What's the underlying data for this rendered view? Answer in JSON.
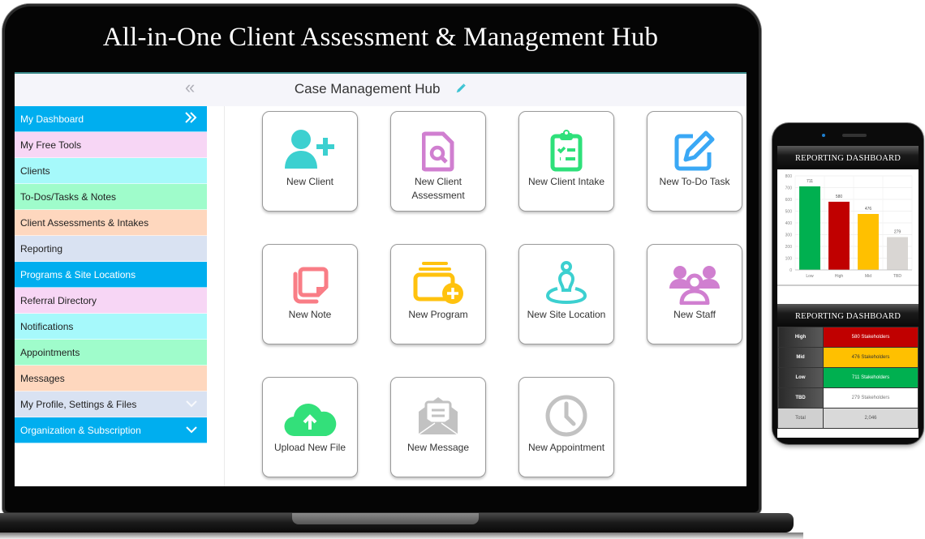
{
  "laptop": {
    "banner_title": "All-in-One Client Assessment & Management Hub",
    "header": {
      "collapse_icon": "double-chevron-left",
      "title": "Case Management Hub",
      "edit_icon": "pencil-icon"
    },
    "sidebar": {
      "items": [
        {
          "label": "My Dashboard",
          "bg": "#00aeef",
          "text_color": "#ffffff",
          "icon": "double-chevron-right"
        },
        {
          "label": "My Free Tools",
          "bg": "#f7d6f5",
          "text_color": "#222222",
          "icon": ""
        },
        {
          "label": "Clients",
          "bg": "#a6f9fb",
          "text_color": "#222222",
          "icon": ""
        },
        {
          "label": "To-Dos/Tasks & Notes",
          "bg": "#9ffccb",
          "text_color": "#222222",
          "icon": ""
        },
        {
          "label": "Client Assessments & Intakes",
          "bg": "#fed7be",
          "text_color": "#222222",
          "icon": ""
        },
        {
          "label": "Reporting",
          "bg": "#d9e2f2",
          "text_color": "#222222",
          "icon": ""
        },
        {
          "label": "Programs & Site Locations",
          "bg": "#00aeef",
          "text_color": "#ffffff",
          "icon": ""
        },
        {
          "label": "Referral Directory",
          "bg": "#f7d6f5",
          "text_color": "#222222",
          "icon": ""
        },
        {
          "label": "Notifications",
          "bg": "#a6f9fb",
          "text_color": "#222222",
          "icon": ""
        },
        {
          "label": "Appointments",
          "bg": "#9ffccb",
          "text_color": "#222222",
          "icon": ""
        },
        {
          "label": "Messages",
          "bg": "#fed7be",
          "text_color": "#222222",
          "icon": ""
        },
        {
          "label": "My Profile, Settings & Files",
          "bg": "#d9e2f2",
          "text_color": "#222222",
          "icon": "chevron-down-light"
        },
        {
          "label": "Organization & Subscription",
          "bg": "#00aeef",
          "text_color": "#ffffff",
          "icon": "chevron-down"
        }
      ]
    },
    "tiles": [
      {
        "label": "New Client",
        "icon": "user-plus-icon",
        "color": "#3cd0d0"
      },
      {
        "label": "New Client Assessment",
        "icon": "file-search-icon",
        "color": "#d07fd0"
      },
      {
        "label": "New Client Intake",
        "icon": "clipboard-check-icon",
        "color": "#2ee07a"
      },
      {
        "label": "New To-Do Task",
        "icon": "edit-square-icon",
        "color": "#3aa8f5"
      },
      {
        "label": "New Note",
        "icon": "notes-icon",
        "color": "#f97d86"
      },
      {
        "label": "New Program",
        "icon": "folder-plus-icon",
        "color": "#ffc20e"
      },
      {
        "label": "New Site Location",
        "icon": "map-person-icon",
        "color": "#3cd0d0"
      },
      {
        "label": "New Staff",
        "icon": "users-group-icon",
        "color": "#d07fd0"
      },
      {
        "label": "Upload New File",
        "icon": "cloud-upload-icon",
        "color": "#33e07a"
      },
      {
        "label": "New Message",
        "icon": "envelope-open-icon",
        "color": "#c2c2c2"
      },
      {
        "label": "New Appointment",
        "icon": "clock-icon",
        "color": "#c2c2c2"
      }
    ]
  },
  "phone": {
    "chart_header": "REPORTING DASHBOARD",
    "table_header": "REPORTING DASHBOARD",
    "table": {
      "rows": [
        {
          "key": "High",
          "value": "580 Stakeholders",
          "bg": "#c00000",
          "text_color": "#ffffff"
        },
        {
          "key": "Mid",
          "value": "476 Stakeholders",
          "bg": "#ffc000",
          "text_color": "#333333"
        },
        {
          "key": "Low",
          "value": "711 Stakeholders",
          "bg": "#00b050",
          "text_color": "#ffffff"
        },
        {
          "key": "TBD",
          "value": "279 Stakeholders",
          "bg": "#ffffff",
          "text_color": "#777777"
        }
      ],
      "total": {
        "key": "Total",
        "value": "2,046"
      }
    }
  },
  "chart_data": {
    "type": "bar",
    "title": "REPORTING DASHBOARD",
    "categories": [
      "Low",
      "High",
      "Mid",
      "TBD"
    ],
    "values": [
      711,
      580,
      476,
      279
    ],
    "colors": [
      "#00b050",
      "#c00000",
      "#ffc000",
      "#d9d6d3"
    ],
    "data_labels": [
      "711",
      "580",
      "476",
      "279"
    ],
    "xlabel": "",
    "ylabel": "",
    "ylim": [
      0,
      800
    ],
    "yticks": [
      0,
      100,
      200,
      300,
      400,
      500,
      600,
      700,
      800
    ],
    "grid": true,
    "legend": "none"
  }
}
